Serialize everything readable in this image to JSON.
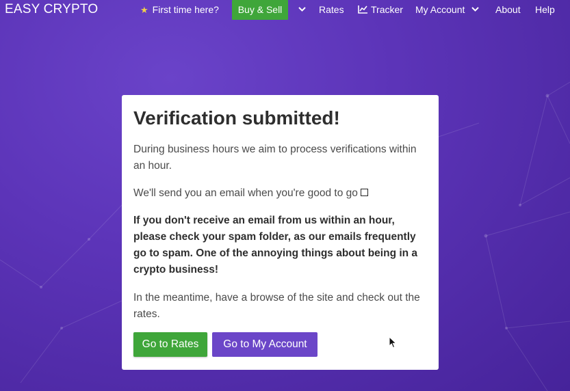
{
  "brand": "EASY CRYPTO",
  "nav": {
    "first_time": "First time here?",
    "buy_sell": "Buy & Sell",
    "rates": "Rates",
    "tracker": "Tracker",
    "my_account": "My Account",
    "about": "About",
    "help": "Help"
  },
  "card": {
    "title": "Verification submitted!",
    "p1": "During business hours we aim to process verifications within an hour.",
    "p2": "We'll send you an email when you're good to go",
    "p3": "If you don't receive an email from us within an hour, please check your spam folder, as our emails frequently go to spam. One of the annoying things about being in a crypto business!",
    "p4": "In the meantime, have a browse of the site and check out the rates."
  },
  "buttons": {
    "go_to_rates": "Go to Rates",
    "go_to_my_account": "Go to My Account"
  },
  "colors": {
    "background": "#5c34b8",
    "green": "#3fa63a",
    "purple": "#6b46c8",
    "star": "#f2d14a"
  },
  "icons": {
    "star": "star-icon",
    "tracker": "line-chart-icon",
    "caret": "chevron-down-icon",
    "checkbox": "empty-box-icon",
    "cursor": "mouse-pointer-icon"
  }
}
